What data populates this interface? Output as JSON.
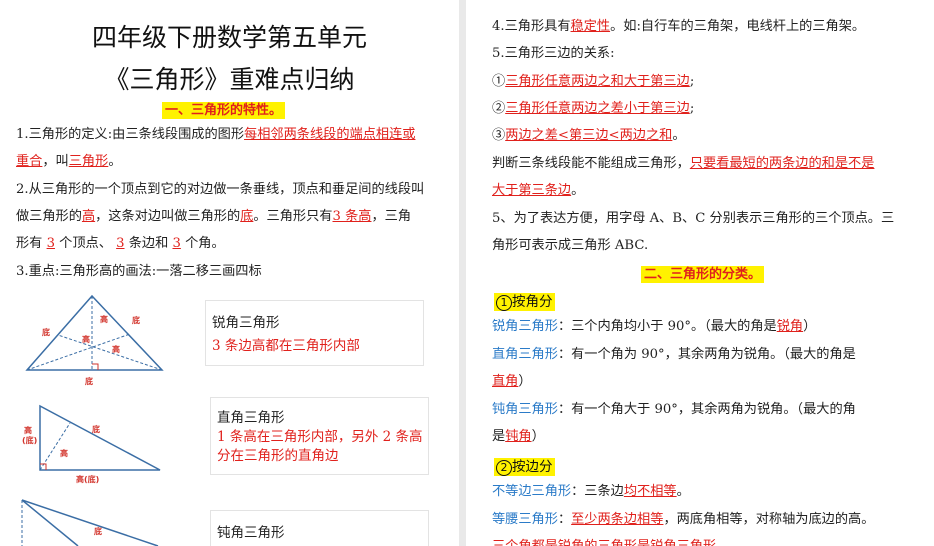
{
  "left": {
    "title1": "四年级下册数学第五单元",
    "title2": "《三角形》重难点归纳",
    "section1": "一、三角形的特性。",
    "p1_a": "1.三角形的定义:由三条线段围成的图形",
    "p1_b": "每相邻两条线段的端点相连或",
    "p1_c": "重合",
    "p1_d": "，叫",
    "p1_e": "三角形",
    "p1_f": "。",
    "p2_a": "2.从三角形的一个顶点到它的对边做一条垂线，顶点和垂足间的线段叫",
    "p2_b": "做三角形的",
    "p2_c": "高",
    "p2_d": "，这条对边叫做三角形的",
    "p2_e": "底",
    "p2_f": "。三角形只有",
    "p2_g": "3 条高",
    "p2_h": "，三角",
    "p2_i": "形有",
    "p2_j": "3",
    "p2_k": "个顶点、",
    "p2_l": "3",
    "p2_m": "条边和",
    "p2_n": "3",
    "p2_o": "个角。",
    "p3": "3.重点:三角形高的画法:一落二移三画四标",
    "fig_label_di": "底",
    "fig_label_gao": "高",
    "fig_label_gao_di": "高(底)",
    "fig_label_gao_paren": "(底)",
    "box1_title": "锐角三角形",
    "box1_desc": "3 条边高都在三角形内部",
    "box2_title": "直角三角形",
    "box2_desc": "1 条高在三角形内部，另外 2 条高分在三角形的直角边",
    "box3_title": "钝角三角形"
  },
  "right": {
    "l1_a": "4.三角形具有",
    "l1_b": "稳定性",
    "l1_c": "。如:自行车的三角架，电线杆上的三角架。",
    "l2": "5.三角形三边的关系:",
    "l3_a": "①",
    "l3_b": "三角形任意两边之和大于第三边",
    "l3_c": ";",
    "l4_a": "②",
    "l4_b": "三角形任意两边之差小于第三边",
    "l4_c": ";",
    "l5_a": "③",
    "l5_b": "两边之差<第三边<两边之和",
    "l5_c": "。",
    "l6_a": "判断三条线段能不能组成三角形，",
    "l6_b": "只要看最短的两条边的和是不是",
    "l6_c": "大于第三条边",
    "l6_d": "。",
    "l7": "5、为了表达方便，用字母 A、B、C 分别表示三角形的三个顶点。三",
    "l8": "角形可表示成三角形 ABC.",
    "section2": "二、三角形的分类。",
    "cat1_num": "1",
    "cat1": "按角分",
    "r1_a": "锐角三角形",
    "r1_b": "：三个内角均小于 90°。（最大的角是",
    "r1_c": "锐角",
    "r1_d": "）",
    "r2_a": "直角三角形",
    "r2_b": "：有一个角为 90°，其余两角为锐角。（最大的角是",
    "r2_c": "直角",
    "r2_d": "）",
    "r3_a": "钝角三角形",
    "r3_b": "：有一个角大于 90°，其余两角为锐角。（最大的角",
    "r3_c": "是",
    "r3_d": "钝角",
    "r3_e": "）",
    "cat2_num": "2",
    "cat2": "按边分",
    "s1_a": "不等边三角形",
    "s1_b": "：三条边",
    "s1_c": "均不相等",
    "s1_d": "。",
    "s2_a": "等腰三角形",
    "s2_b": "：",
    "s2_c": "至少两条边相等",
    "s2_d": "，两底角相等，对称轴为底边的高。",
    "s3": "三个角都是锐角的三角形是锐角三角形"
  }
}
